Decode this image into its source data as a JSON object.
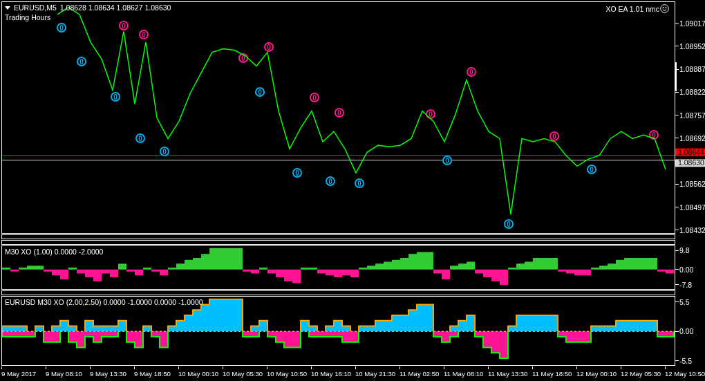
{
  "main_chart": {
    "title": "EURUSD,M5",
    "quote": "1.08628 1.08634 1.08627 1.08630",
    "subtitle": "Trading Hours",
    "expert_label": "XO EA 1.01 nmc",
    "signals": [
      {
        "text": "0",
        "color": "#00b0f0"
      },
      {
        "text": "0",
        "color": "#00b0f0"
      },
      {
        "text": "0",
        "color": "#00b0f0"
      },
      {
        "text": "0",
        "color": "#00b0f0"
      },
      {
        "text": "0",
        "color": "#00b0f0"
      },
      {
        "text": "0",
        "color": "#00b0f0"
      },
      {
        "text": "0",
        "color": "#00b0f0"
      },
      {
        "text": "0",
        "color": "#00b0f0"
      },
      {
        "text": "0",
        "color": "#00b0f0"
      },
      {
        "text": "0",
        "color": "#00b0f0"
      },
      {
        "text": "0",
        "color": "#00b0f0"
      },
      {
        "text": "0",
        "color": "#00b0f0"
      },
      {
        "text": "0",
        "color": "#ff1a8c"
      },
      {
        "text": "0",
        "color": "#ff1a8c"
      },
      {
        "text": "0",
        "color": "#ff1a8c"
      },
      {
        "text": "0",
        "color": "#ff1a8c"
      },
      {
        "text": "0",
        "color": "#ff1a8c"
      },
      {
        "text": "0",
        "color": "#ff1a8c"
      },
      {
        "text": "0",
        "color": "#ff1a8c"
      },
      {
        "text": "0",
        "color": "#ff1a8c"
      },
      {
        "text": "0",
        "color": "#ff1a8c"
      },
      {
        "text": "0",
        "color": "#ff1a8c"
      }
    ],
    "chart_data": {
      "type": "line",
      "ylim": [
        1.08424,
        1.09077
      ],
      "ref_lines": [
        {
          "axis": "y",
          "value": 1.08644,
          "label": "1.08644",
          "color": "#ff0000"
        },
        {
          "axis": "y",
          "value": 1.0863,
          "label": "1.08630",
          "color": "#d8d8d8"
        }
      ],
      "yticks": [
        {
          "value": 1.09017,
          "label": "1.09017"
        },
        {
          "value": 1.08952,
          "label": "1.08952"
        },
        {
          "value": 1.08887,
          "label": "1.08887"
        },
        {
          "value": 1.08822,
          "label": "1.08822"
        },
        {
          "value": 1.08757,
          "label": "1.08757"
        },
        {
          "value": 1.08692,
          "label": "1.08692"
        },
        {
          "value": 1.08562,
          "label": "1.08562"
        },
        {
          "value": 1.08497,
          "label": "1.08497"
        },
        {
          "value": 1.08432,
          "label": "1.08432"
        }
      ],
      "categories": [
        null,
        null,
        null,
        null,
        null,
        null,
        null,
        null,
        null,
        null,
        null,
        null,
        null,
        null,
        null,
        null,
        null,
        null,
        null,
        null,
        null,
        null,
        null,
        null,
        null,
        null,
        null,
        null,
        null,
        null,
        null,
        null,
        null,
        null,
        null,
        null,
        null,
        null,
        null,
        null,
        null,
        null,
        null,
        null,
        null,
        null,
        null,
        null,
        null,
        null,
        null,
        null,
        null,
        null,
        null,
        null,
        null,
        null,
        null,
        null,
        null
      ],
      "series": [
        {
          "color": "#00ff00",
          "values": [
            null,
            null,
            null,
            null,
            null,
            1.09042,
            1.09062,
            1.09042,
            1.08964,
            1.08916,
            1.08828,
            1.08994,
            1.08789,
            1.08964,
            1.0875,
            1.08691,
            1.0874,
            1.08818,
            1.08877,
            1.08935,
            1.08945,
            1.08941,
            1.08925,
            1.08896,
            1.08935,
            1.08769,
            1.08662,
            1.08721,
            1.08769,
            1.08682,
            1.08711,
            1.08662,
            1.08594,
            1.08652,
            1.08672,
            1.08668,
            1.08672,
            1.08691,
            1.08769,
            1.0874,
            1.08682,
            1.0876,
            1.08857,
            1.08769,
            1.08711,
            1.08691,
            1.08477,
            1.08691,
            1.08682,
            1.08691,
            1.08682,
            1.08643,
            1.08613,
            1.08633,
            1.08643,
            1.08691,
            1.08711,
            1.08691,
            1.08701,
            1.08691,
            1.08604
          ]
        }
      ]
    }
  },
  "indicator_1": {
    "title": "M30 XO (1.00) 0.0000 -2.0000",
    "axis_labels": [
      "9.8",
      "0.00",
      "-7.8"
    ]
  },
  "indicator_2": {
    "title": "EURUSD M30 XO (2.00,2.50) 0.0000 -1.0000 0.0000 -1.0000",
    "axis_labels": [
      "5.5",
      "0.00",
      "-5.5"
    ]
  },
  "time_axis": {
    "labels": [
      "9 May 2017",
      "9 May 08:10",
      "9 May 13:30",
      "9 May 18:50",
      "10 May 00:10",
      "10 May 05:30",
      "10 May 10:50",
      "10 May 16:10",
      "10 May 21:30",
      "11 May 02:50",
      "11 May 08:10",
      "11 May 13:30",
      "11 May 18:50",
      "12 May 00:10",
      "12 May 05:30",
      "12 May 10:50"
    ]
  }
}
